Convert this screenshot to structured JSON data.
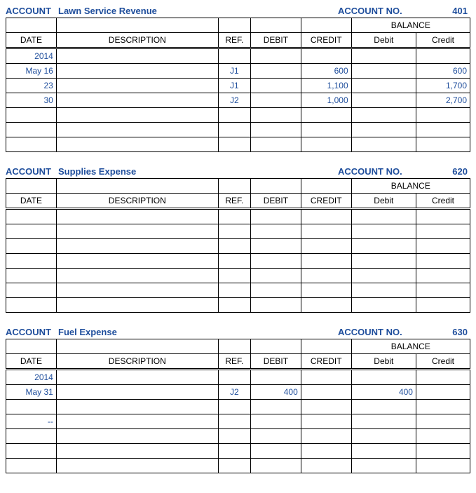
{
  "labels": {
    "account": "ACCOUNT",
    "account_no": "ACCOUNT NO.",
    "date": "DATE",
    "description": "DESCRIPTION",
    "ref": "REF.",
    "debit": "DEBIT",
    "credit": "CREDIT",
    "balance": "BALANCE",
    "bal_debit": "Debit",
    "bal_credit": "Credit"
  },
  "ledgers": [
    {
      "name": "Lawn Service Revenue",
      "number": "401",
      "rows": [
        {
          "date": "2014",
          "desc": "",
          "ref": "",
          "debit": "",
          "credit": "",
          "bdebit": "",
          "bcredit": ""
        },
        {
          "date": "May 16",
          "desc": "",
          "ref": "J1",
          "debit": "",
          "credit": "600",
          "bdebit": "",
          "bcredit": "600"
        },
        {
          "date": "23",
          "desc": "",
          "ref": "J1",
          "debit": "",
          "credit": "1,100",
          "bdebit": "",
          "bcredit": "1,700"
        },
        {
          "date": "30",
          "desc": "",
          "ref": "J2",
          "debit": "",
          "credit": "1,000",
          "bdebit": "",
          "bcredit": "2,700"
        },
        {
          "date": "",
          "desc": "",
          "ref": "",
          "debit": "",
          "credit": "",
          "bdebit": "",
          "bcredit": ""
        },
        {
          "date": "",
          "desc": "",
          "ref": "",
          "debit": "",
          "credit": "",
          "bdebit": "",
          "bcredit": ""
        },
        {
          "date": "",
          "desc": "",
          "ref": "",
          "debit": "",
          "credit": "",
          "bdebit": "",
          "bcredit": ""
        }
      ]
    },
    {
      "name": "Supplies Expense",
      "number": "620",
      "rows": [
        {
          "date": "",
          "desc": "",
          "ref": "",
          "debit": "",
          "credit": "",
          "bdebit": "",
          "bcredit": ""
        },
        {
          "date": "",
          "desc": "",
          "ref": "",
          "debit": "",
          "credit": "",
          "bdebit": "",
          "bcredit": ""
        },
        {
          "date": "",
          "desc": "",
          "ref": "",
          "debit": "",
          "credit": "",
          "bdebit": "",
          "bcredit": ""
        },
        {
          "date": "",
          "desc": "",
          "ref": "",
          "debit": "",
          "credit": "",
          "bdebit": "",
          "bcredit": ""
        },
        {
          "date": "",
          "desc": "",
          "ref": "",
          "debit": "",
          "credit": "",
          "bdebit": "",
          "bcredit": ""
        },
        {
          "date": "",
          "desc": "",
          "ref": "",
          "debit": "",
          "credit": "",
          "bdebit": "",
          "bcredit": ""
        },
        {
          "date": "",
          "desc": "",
          "ref": "",
          "debit": "",
          "credit": "",
          "bdebit": "",
          "bcredit": ""
        }
      ]
    },
    {
      "name": "Fuel Expense",
      "number": "630",
      "rows": [
        {
          "date": "2014",
          "desc": "",
          "ref": "",
          "debit": "",
          "credit": "",
          "bdebit": "",
          "bcredit": ""
        },
        {
          "date": "May 31",
          "desc": "",
          "ref": "J2",
          "debit": "400",
          "credit": "",
          "bdebit": "400",
          "bcredit": ""
        },
        {
          "date": "",
          "desc": "",
          "ref": "",
          "debit": "",
          "credit": "",
          "bdebit": "",
          "bcredit": ""
        },
        {
          "date": "--",
          "desc": "",
          "ref": "",
          "debit": "",
          "credit": "",
          "bdebit": "",
          "bcredit": ""
        },
        {
          "date": "",
          "desc": "",
          "ref": "",
          "debit": "",
          "credit": "",
          "bdebit": "",
          "bcredit": ""
        },
        {
          "date": "",
          "desc": "",
          "ref": "",
          "debit": "",
          "credit": "",
          "bdebit": "",
          "bcredit": ""
        },
        {
          "date": "",
          "desc": "",
          "ref": "",
          "debit": "",
          "credit": "",
          "bdebit": "",
          "bcredit": ""
        }
      ]
    }
  ]
}
